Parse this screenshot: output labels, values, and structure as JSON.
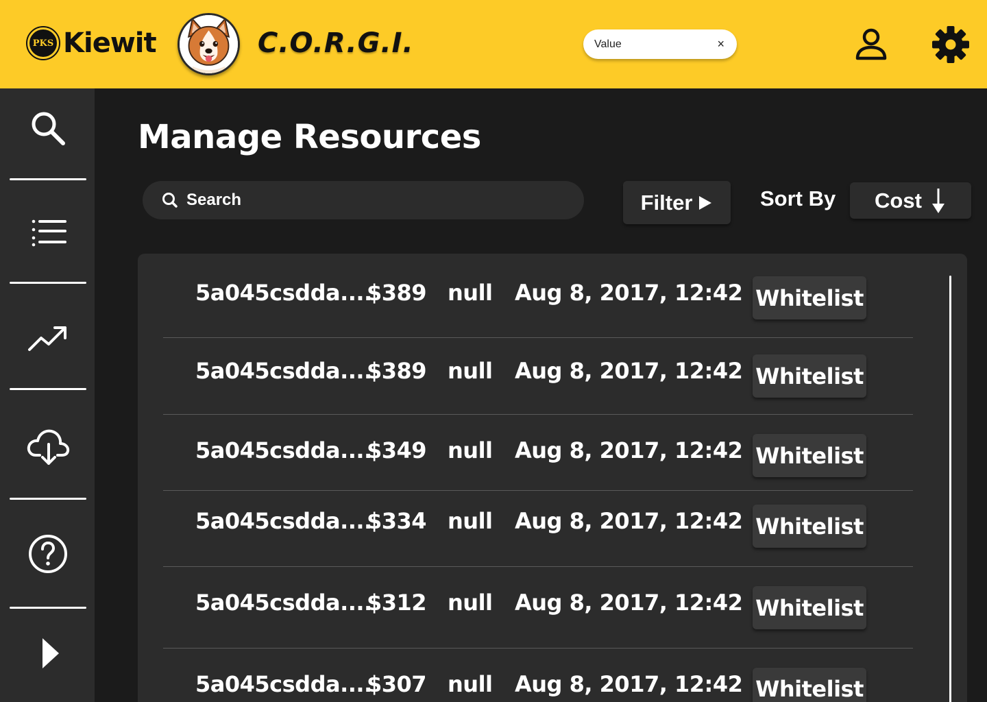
{
  "header": {
    "brand_name": "Kiewit",
    "brand_seal": "PKS",
    "app_title": "C.O.R.G.I.",
    "filter_chip": {
      "value": "Value",
      "clear_icon": "×"
    }
  },
  "sidebar": {
    "items": [
      {
        "name": "search",
        "icon": "search-icon"
      },
      {
        "name": "list",
        "icon": "list-icon"
      },
      {
        "name": "trends",
        "icon": "trending-up-icon"
      },
      {
        "name": "download",
        "icon": "cloud-download-icon"
      },
      {
        "name": "help",
        "icon": "help-circle-icon"
      },
      {
        "name": "expand",
        "icon": "play-icon"
      }
    ]
  },
  "main": {
    "title": "Manage Resources",
    "search_label": "Search",
    "filter_label": "Filter",
    "sort_label": "Sort By",
    "sort_value": "Cost"
  },
  "rows": [
    {
      "id": "5a045csdda....",
      "cost": "$389",
      "value": "null",
      "date": "Aug 8, 2017, 12:42",
      "action": "Whitelist"
    },
    {
      "id": "5a045csdda....",
      "cost": "$389",
      "value": "null",
      "date": "Aug 8, 2017, 12:42",
      "action": "Whitelist"
    },
    {
      "id": "5a045csdda....",
      "cost": "$349",
      "value": "null",
      "date": "Aug 8, 2017, 12:42",
      "action": "Whitelist"
    },
    {
      "id": "5a045csdda....",
      "cost": "$334",
      "value": "null",
      "date": "Aug 8, 2017, 12:42",
      "action": "Whitelist"
    },
    {
      "id": "5a045csdda....",
      "cost": "$312",
      "value": "null",
      "date": "Aug 8, 2017, 12:42",
      "action": "Whitelist"
    },
    {
      "id": "5a045csdda....",
      "cost": "$307",
      "value": "null",
      "date": "Aug 8, 2017, 12:42",
      "action": "Whitelist"
    }
  ],
  "colors": {
    "header_bg": "#fdcb27",
    "sidebar_bg": "#2c2c2c",
    "page_bg": "#1b1b1b",
    "panel_bg": "#2c2c2c"
  }
}
